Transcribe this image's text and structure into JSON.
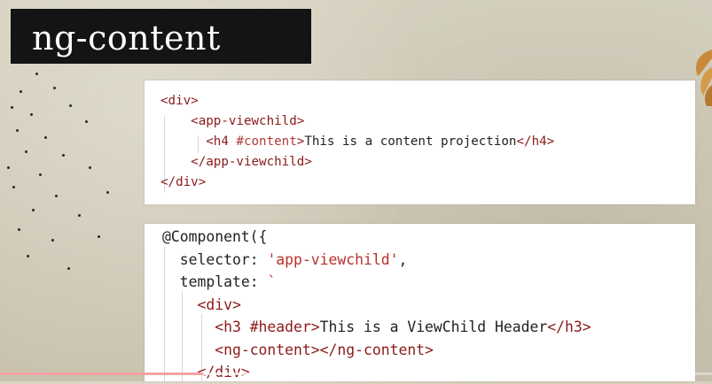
{
  "slide": {
    "title": "ng-content"
  },
  "snippet1": {
    "lines": [
      {
        "indent": "",
        "parts": [
          {
            "t": "tag",
            "v": "<div>"
          }
        ]
      },
      {
        "indent": "    ",
        "parts": [
          {
            "t": "tag",
            "v": "<app-viewchild>"
          }
        ]
      },
      {
        "indent": "      ",
        "parts": [
          {
            "t": "tag",
            "v": "<h4 "
          },
          {
            "t": "attr",
            "v": "#content"
          },
          {
            "t": "tag",
            "v": ">"
          },
          {
            "t": "txt",
            "v": "This is a content projection"
          },
          {
            "t": "tag",
            "v": "</h4>"
          }
        ]
      },
      {
        "indent": "    ",
        "parts": [
          {
            "t": "tag",
            "v": "</app-viewchild>"
          }
        ]
      },
      {
        "indent": "",
        "parts": [
          {
            "t": "tag",
            "v": "</div>"
          }
        ]
      }
    ]
  },
  "snippet2": {
    "lines": [
      {
        "indent": "",
        "parts": [
          {
            "t": "txt",
            "v": "@Component({"
          }
        ]
      },
      {
        "indent": "  ",
        "parts": [
          {
            "t": "txt",
            "v": "selector: "
          },
          {
            "t": "str",
            "v": "'app-viewchild'"
          },
          {
            "t": "txt",
            "v": ","
          }
        ]
      },
      {
        "indent": "  ",
        "parts": [
          {
            "t": "txt",
            "v": "template: "
          },
          {
            "t": "str",
            "v": "`"
          }
        ]
      },
      {
        "indent": "    ",
        "parts": [
          {
            "t": "tag",
            "v": "<div>"
          }
        ]
      },
      {
        "indent": "      ",
        "parts": [
          {
            "t": "tag",
            "v": "<h3 #header>"
          },
          {
            "t": "txt",
            "v": "This is a ViewChild Header"
          },
          {
            "t": "tag",
            "v": "</h3>"
          }
        ]
      },
      {
        "indent": "      ",
        "parts": [
          {
            "t": "tag",
            "v": "<ng-content></ng-content>"
          }
        ]
      },
      {
        "indent": "    ",
        "parts": [
          {
            "t": "tag",
            "v": "</div>"
          }
        ]
      }
    ]
  },
  "player": {
    "progress_fraction": 0.285,
    "buffered_fraction": 0.41,
    "progress_color": "#e01b1b"
  }
}
